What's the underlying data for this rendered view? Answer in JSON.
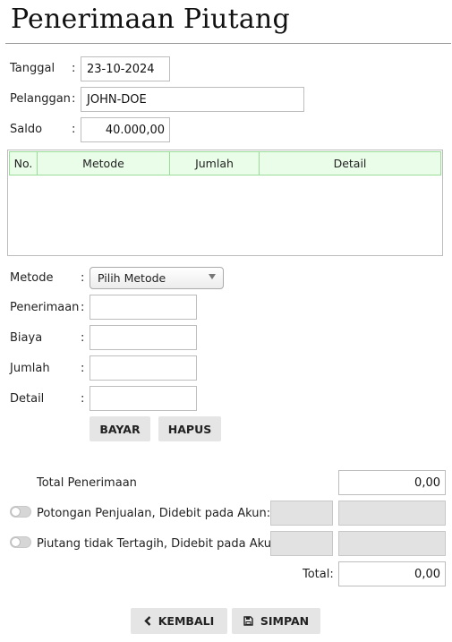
{
  "page": {
    "title": "Penerimaan Piutang"
  },
  "header_form": {
    "tanggal": {
      "label": "Tanggal",
      "value": "23-10-2024"
    },
    "pelanggan": {
      "label": "Pelanggan",
      "value": "JOHN-DOE"
    },
    "saldo": {
      "label": "Saldo",
      "value": "40.000,00"
    }
  },
  "table": {
    "columns": [
      "No.",
      "Metode",
      "Jumlah",
      "Detail"
    ],
    "rows": []
  },
  "entry_form": {
    "metode": {
      "label": "Metode",
      "selected": "Pilih Metode"
    },
    "penerimaan": {
      "label": "Penerimaan",
      "value": ""
    },
    "biaya": {
      "label": "Biaya",
      "value": ""
    },
    "jumlah": {
      "label": "Jumlah",
      "value": ""
    },
    "detail": {
      "label": "Detail",
      "value": ""
    },
    "bayar_label": "BAYAR",
    "hapus_label": "HAPUS"
  },
  "summary": {
    "total_penerimaan": {
      "label": "Total Penerimaan",
      "value": "0,00"
    },
    "potongan": {
      "label": "Potongan Penjualan, Didebit pada Akun:",
      "enabled": false
    },
    "piutang_tidak_tertagih": {
      "label": "Piutang tidak Tertagih, Didebit pada Akun:",
      "enabled": false
    },
    "total": {
      "label": "Total:",
      "value": "0,00"
    }
  },
  "footer": {
    "kembali_label": "KEMBALI",
    "simpan_label": "SIMPAN",
    "kembali_icon": "chevron-left-icon",
    "simpan_icon": "floppy-disk-icon"
  },
  "colors": {
    "table_header_bg": "#e9fde9",
    "table_header_border": "#99dd99",
    "button_bg": "#e5e5e5"
  }
}
